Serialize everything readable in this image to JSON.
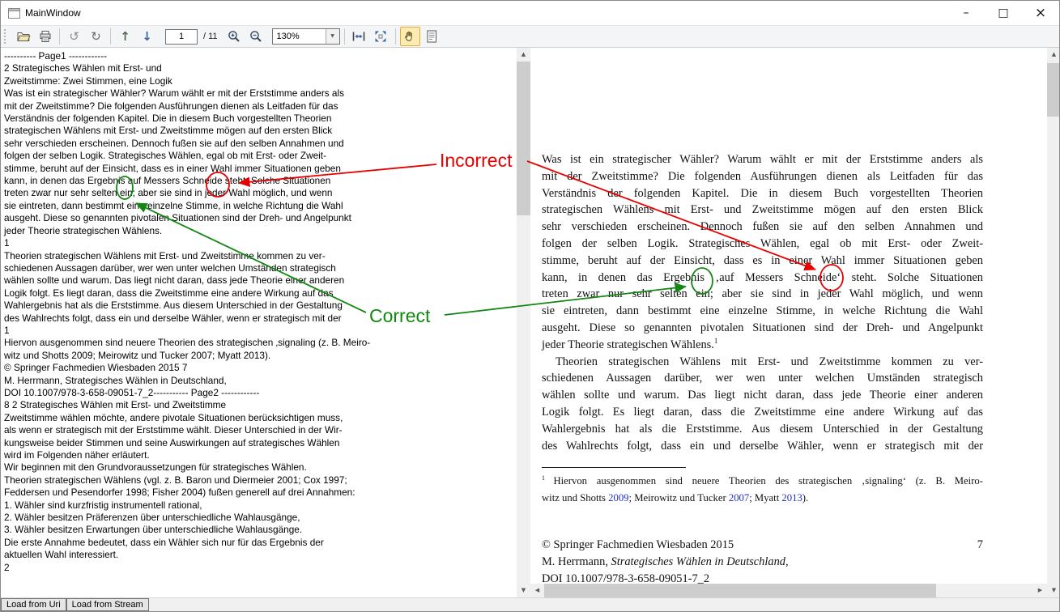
{
  "window": {
    "title": "MainWindow",
    "controls": {
      "minimize": "–",
      "maximize": "□",
      "close": "×"
    }
  },
  "toolbar": {
    "icons": [
      "open-file",
      "print",
      "undo",
      "redo",
      "previous-page",
      "next-page",
      "zoom-in",
      "zoom-out",
      "zoom-select",
      "fit-width",
      "fit-page",
      "hand-tool",
      "text-select"
    ],
    "selected_tool": "hand-tool",
    "page_number": "1",
    "page_total_label": "/ 11",
    "zoom_value": "130%",
    "glyphs": {
      "undo": "↺",
      "redo": "↻",
      "prev": "↑",
      "next": "↓",
      "dropdown": "▼"
    }
  },
  "scrollbar": {
    "up": "▲",
    "down": "▼",
    "left": "◀",
    "right": "▶"
  },
  "left_panel": {
    "lines": [
      "---------- Page1 ------------",
      "2 Strategisches Wählen mit Erst- und",
      "Zweitstimme: Zwei Stimmen, eine Logik",
      "Was ist ein strategischer Wähler? Warum wählt er mit der Erststimme anders als",
      "mit der Zweitstimme? Die folgenden Ausführungen dienen als Leitfaden für das",
      "Verständnis der folgenden Kapitel. Die in diesem Buch vorgestellten Theorien",
      "strategischen Wählens mit Erst- und Zweitstimme mögen auf den ersten Blick",
      "sehr verschieden erscheinen. Dennoch fußen sie auf den selben Annahmen und",
      "folgen der selben Logik. Strategisches Wählen, egal ob mit Erst- oder Zweit-",
      "stimme, beruht auf der Einsicht, dass es in einer Wahl immer Situationen geben",
      "kann, in denen das Ergebnis auf Messers Schneide steht. Solche Situationen",
      "treten zwar nur sehr selten ein; aber sie sind in jeder Wahl möglich, und wenn",
      "sie eintreten, dann bestimmt eine einzelne Stimme, in welche Richtung die Wahl",
      "ausgeht. Diese so genannten pivotalen Situationen sind der Dreh- und Angelpunkt",
      "jeder Theorie strategischen Wählens.",
      "1",
      "Theorien strategischen Wählens mit Erst- und Zweitstimme kommen zu ver-",
      "schiedenen Aussagen darüber, wer wen unter welchen Umständen strategisch",
      "wählen sollte und warum. Das liegt nicht daran, dass jede Theorie einer anderen",
      "Logik folgt. Es liegt daran, dass die Zweitstimme eine andere Wirkung auf das",
      "Wahlergebnis hat als die Erststimme. Aus diesem Unterschied in der Gestaltung",
      "des Wahlrechts folgt, dass ein und derselbe Wähler, wenn er strategisch mit der",
      "1",
      "Hiervon ausgenommen sind neuere Theorien des strategischen ‚signaling (z. B. Meiro-",
      "witz und Shotts 2009; Meirowitz und Tucker 2007; Myatt 2013).",
      "© Springer Fachmedien Wiesbaden 2015 7",
      "M. Herrmann, Strategisches Wählen in Deutschland,",
      "DOI 10.1007/978-3-658-09051-7_2----------- Page2 ------------",
      "8 2 Strategisches Wählen mit Erst- und Zweitstimme",
      "Zweitstimme wählen möchte, andere pivotale Situationen berücksichtigen muss,",
      "als wenn er strategisch mit der Erststimme wählt. Dieser Unterschied in der Wir-",
      "kungsweise beider Stimmen und seine Auswirkungen auf strategisches Wählen",
      "wird im Folgenden näher erläutert.",
      "Wir beginnen mit den Grundvoraussetzungen für strategisches Wählen.",
      "Theorien strategischen Wählens (vgl. z. B. Baron und Diermeier 2001; Cox 1997;",
      "Feddersen und Pesendorfer 1998; Fisher 2004) fußen generell auf drei Annahmen:",
      "1. Wähler sind kurzfristig instrumentell rational,",
      "2. Wähler besitzen Präferenzen über unterschiedliche Wahlausgänge,",
      "3. Wähler besitzen Erwartungen über unterschiedliche Wahlausgänge.",
      "Die erste Annahme bedeutet, dass ein Wähler sich nur für das Ergebnis der",
      "aktuellen Wahl interessiert.",
      "2"
    ]
  },
  "right_panel": {
    "para1": [
      "Was ist ein strategischer Wähler? Warum wählt er mit der Erststimme anders als",
      "mit der Zweitstimme? Die folgenden Ausführungen dienen als Leitfaden für das",
      "Verständnis der folgenden Kapitel. Die in diesem Buch vorgestellten Theorien",
      "strategischen Wählens mit Erst- und Zweitstimme mögen auf den ersten Blick",
      "sehr verschieden erscheinen. Dennoch fußen sie auf den selben Annahmen und",
      "folgen der selben Logik. Strategisches Wählen, egal ob mit Erst- oder Zweit-",
      "stimme, beruht auf der Einsicht, dass es in einer Wahl immer Situationen geben",
      "kann, in denen das Ergebnis ‚auf Messers Schneide‘ steht. Solche Situationen",
      "treten zwar nur sehr selten ein; aber sie sind in jeder Wahl möglich, und wenn",
      "sie eintreten, dann bestimmt eine einzelne Stimme, in welche Richtung die Wahl",
      "ausgeht. Diese so genannten pivotalen Situationen sind der Dreh- und Angelpunkt",
      {
        "c": "jlast",
        "s": [
          {
            "t": "jeder Theorie strategischen Wählens."
          },
          {
            "t": "1",
            "c": "sup"
          }
        ]
      }
    ],
    "para2": [
      {
        "c": "indent",
        "t": "Theorien strategischen Wählens mit Erst- und Zweitstimme kommen zu ver-"
      },
      "schiedenen Aussagen darüber, wer wen unter welchen Umständen strategisch",
      "wählen sollte und warum. Das liegt nicht daran, dass jede Theorie einer anderen",
      "Logik folgt. Es liegt daran, dass die Zweitstimme eine andere Wirkung auf das",
      "Wahlergebnis hat als die Erststimme. Aus diesem Unterschied in der Gestaltung",
      "des Wahlrechts folgt, dass ein und derselbe Wähler, wenn er strategisch mit der"
    ],
    "footnote": [
      {
        "s": [
          {
            "t": "1 ",
            "c": "sup"
          },
          {
            "t": "Hiervon ausgenommen sind neuere Theorien des strategischen ‚signaling‘ (z. B. Meiro-"
          }
        ]
      },
      {
        "c": "jlast",
        "s": [
          {
            "t": "witz und Shotts "
          },
          {
            "t": "2009",
            "c": "link"
          },
          {
            "t": "; Meirowitz und Tucker "
          },
          {
            "t": "2007",
            "c": "link"
          },
          {
            "t": "; Myatt "
          },
          {
            "t": "2013",
            "c": "link"
          },
          {
            "t": ")."
          }
        ]
      }
    ],
    "copyright_line": "© Springer Fachmedien Wiesbaden 2015",
    "page_number": "7",
    "author": [
      {
        "c": "jlast",
        "s": [
          {
            "t": "M. Herrmann, "
          },
          {
            "t": "Strategisches Wählen in Deutschland,",
            "c": "ital"
          }
        ]
      }
    ],
    "doi_line": "DOI 10.1007/978-3-658-09051-7_2"
  },
  "annotations": {
    "incorrect_label": "Incorrect",
    "correct_label": "Correct"
  },
  "colors": {
    "annotation_incorrect": "#e60000",
    "annotation_correct": "#128712",
    "link_blue": "#2333c2",
    "hand_tool_highlight": "#fdebb2"
  },
  "footer": {
    "load_uri_label": "Load from Uri",
    "load_stream_label": "Load from Stream"
  }
}
